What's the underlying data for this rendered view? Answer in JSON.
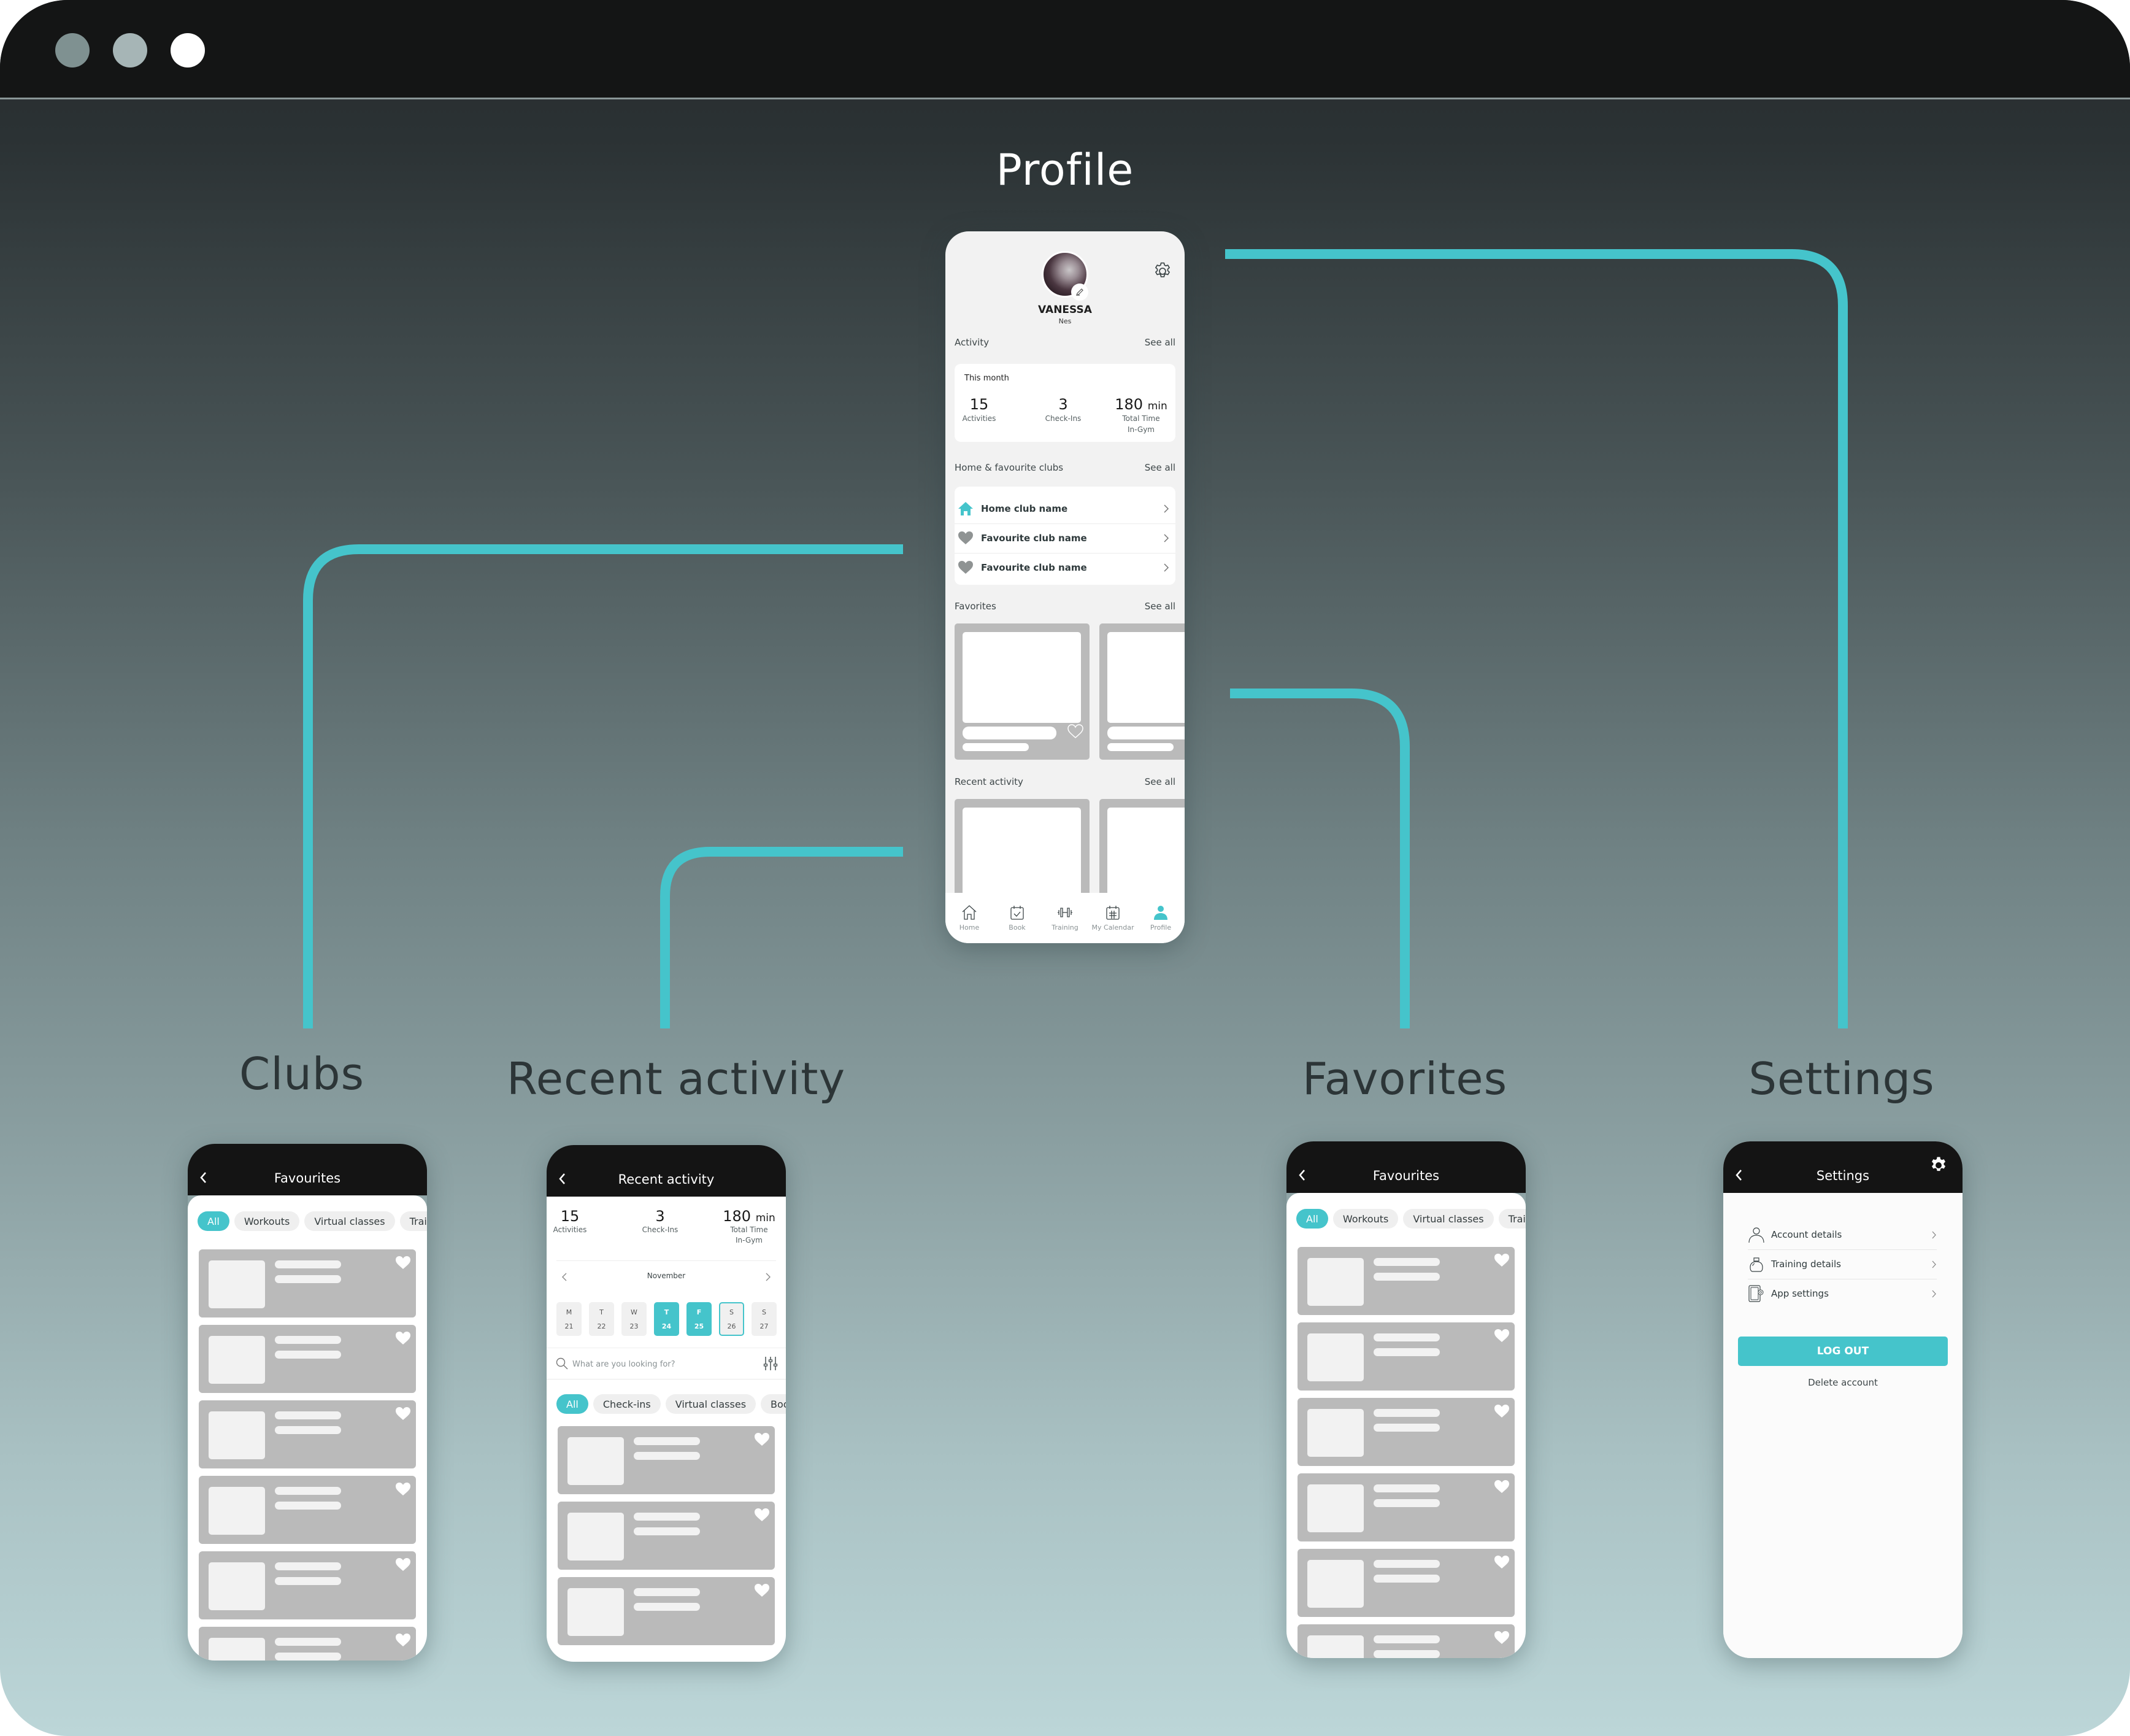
{
  "window": {
    "controls": [
      "window-dot-1",
      "window-dot-2",
      "window-dot-3"
    ]
  },
  "headings": {
    "profile": "Profile",
    "clubs": "Clubs",
    "recent_activity": "Recent activity",
    "favorites": "Favorites",
    "settings": "Settings"
  },
  "colors": {
    "accent": "#45c4cb",
    "header_dark": "#141414",
    "placeholder_gray": "#bababa"
  },
  "profile": {
    "name": "VANESSA",
    "nickname": "Nes",
    "activity": {
      "label": "Activity",
      "see_all": "See all",
      "period": "This month",
      "activities_value": "15",
      "activities_label": "Activities",
      "checkins_value": "3",
      "checkins_label": "Check-Ins",
      "time_value": "180",
      "time_unit": "min",
      "time_label_1": "Total Time",
      "time_label_2": "In-Gym"
    },
    "clubs": {
      "label": "Home & favourite clubs",
      "see_all": "See all",
      "items": [
        {
          "icon": "home-icon",
          "label": "Home club name"
        },
        {
          "icon": "heart-icon",
          "label": "Favourite club name"
        },
        {
          "icon": "heart-icon",
          "label": "Favourite club name"
        }
      ]
    },
    "favorites": {
      "label": "Favorites",
      "see_all": "See all"
    },
    "recent": {
      "label": "Recent activity",
      "see_all": "See all"
    },
    "tabs": [
      {
        "icon": "home-icon",
        "label": "Home"
      },
      {
        "icon": "book-calendar-icon",
        "label": "Book"
      },
      {
        "icon": "dumbbell-icon",
        "label": "Training"
      },
      {
        "icon": "calendar-grid-icon",
        "label": "My Calendar"
      },
      {
        "icon": "person-icon",
        "label": "Profile",
        "active": true
      }
    ]
  },
  "clubs_screen": {
    "title": "Favourites",
    "chips": [
      "All",
      "Workouts",
      "Virtual classes",
      "Trai"
    ],
    "active_chip": "All"
  },
  "recent_screen": {
    "title": "Recent activity",
    "stats": {
      "activities_value": "15",
      "activities_label": "Activities",
      "checkins_value": "3",
      "checkins_label": "Check-Ins",
      "time_value": "180",
      "time_unit": "min",
      "time_label_1": "Total Time",
      "time_label_2": "In-Gym"
    },
    "month": "November",
    "days": [
      {
        "letter": "M",
        "num": "21",
        "state": "normal"
      },
      {
        "letter": "T",
        "num": "22",
        "state": "normal"
      },
      {
        "letter": "W",
        "num": "23",
        "state": "normal"
      },
      {
        "letter": "T",
        "num": "24",
        "state": "selected"
      },
      {
        "letter": "F",
        "num": "25",
        "state": "selected"
      },
      {
        "letter": "S",
        "num": "26",
        "state": "today"
      },
      {
        "letter": "S",
        "num": "27",
        "state": "normal"
      }
    ],
    "search_placeholder": "What are you looking for?",
    "chips": [
      "All",
      "Check-ins",
      "Virtual classes",
      "Boo"
    ],
    "active_chip": "All"
  },
  "favorites_screen": {
    "title": "Favourites",
    "chips": [
      "All",
      "Workouts",
      "Virtual classes",
      "Trai"
    ],
    "active_chip": "All"
  },
  "settings_screen": {
    "title": "Settings",
    "items": [
      {
        "icon": "person-outline-icon",
        "label": "Account details"
      },
      {
        "icon": "kettlebell-icon",
        "label": "Training details"
      },
      {
        "icon": "phone-gear-icon",
        "label": "App settings"
      }
    ],
    "logout_label": "LOG OUT",
    "delete_label": "Delete account"
  }
}
